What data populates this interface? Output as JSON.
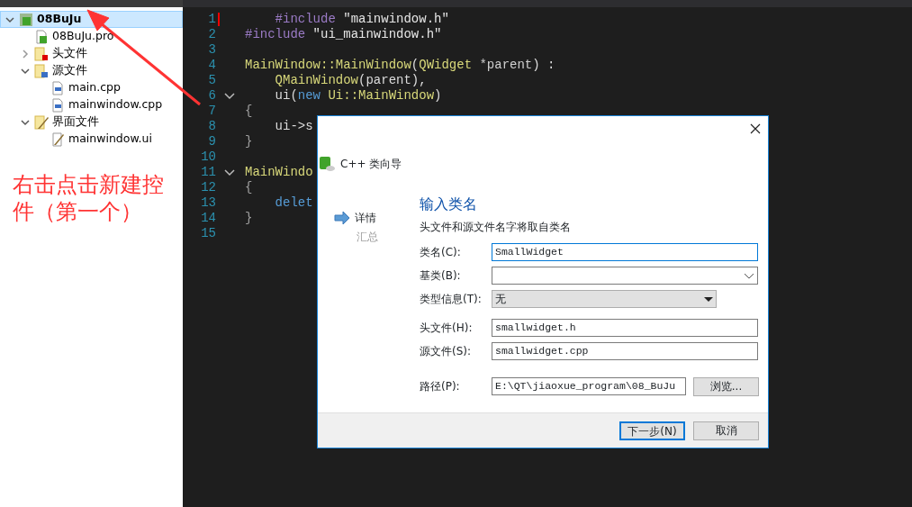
{
  "project_tree": [
    {
      "label": "08BuJu",
      "kind": "project",
      "selected": true,
      "expanded": true,
      "children": [
        {
          "label": "08BuJu.pro",
          "kind": "pro",
          "selected": false
        },
        {
          "label": "头文件",
          "kind": "header-folder",
          "selected": false,
          "expanded": false
        },
        {
          "label": "源文件",
          "kind": "source-folder",
          "selected": false,
          "expanded": true,
          "children": [
            {
              "label": "main.cpp",
              "kind": "cpp",
              "selected": false
            },
            {
              "label": "mainwindow.cpp",
              "kind": "cpp",
              "selected": false
            }
          ]
        },
        {
          "label": "界面文件",
          "kind": "form-folder",
          "selected": false,
          "expanded": true,
          "children": [
            {
              "label": "mainwindow.ui",
              "kind": "ui",
              "selected": false
            }
          ]
        }
      ]
    }
  ],
  "editor": {
    "lines": [
      {
        "number": "1",
        "modified": true,
        "foldable": false,
        "tokens": [
          {
            "text": "    #include",
            "kind": "preproc"
          },
          {
            "text": " \"mainwindow.h\"",
            "kind": "string"
          }
        ]
      },
      {
        "number": "2",
        "modified": false,
        "foldable": false,
        "tokens": [
          {
            "text": "#include",
            "kind": "preproc"
          },
          {
            "text": " \"ui_mainwindow.h\"",
            "kind": "string"
          }
        ]
      },
      {
        "number": "3",
        "modified": false,
        "foldable": false
      },
      {
        "number": "4",
        "modified": false,
        "foldable": false,
        "tokens": [
          {
            "text": "MainWindow::MainWindow",
            "kind": "type"
          },
          {
            "text": "(",
            "kind": "plain"
          },
          {
            "text": "QWidget",
            "kind": "type"
          },
          {
            "text": " *parent",
            "kind": "param"
          },
          {
            "text": ") :",
            "kind": "plain"
          }
        ]
      },
      {
        "number": "5",
        "modified": false,
        "foldable": false,
        "tokens": [
          {
            "text": "    QMainWindow",
            "kind": "type"
          },
          {
            "text": "(parent),",
            "kind": "plain"
          }
        ]
      },
      {
        "number": "6",
        "modified": false,
        "foldable": true,
        "tokens": [
          {
            "text": "    ui(",
            "kind": "plain"
          },
          {
            "text": "new",
            "kind": "keyword"
          },
          {
            "text": " Ui::MainWindow",
            "kind": "type"
          },
          {
            "text": ")",
            "kind": "plain"
          }
        ]
      },
      {
        "number": "7",
        "modified": false,
        "foldable": false,
        "tokens": [
          {
            "text": "{",
            "kind": "brace"
          }
        ]
      },
      {
        "number": "8",
        "modified": false,
        "foldable": false,
        "tokens": [
          {
            "text": "    ui->s",
            "kind": "plain"
          }
        ]
      },
      {
        "number": "9",
        "modified": false,
        "foldable": false,
        "tokens": [
          {
            "text": "}",
            "kind": "brace"
          }
        ]
      },
      {
        "number": "10",
        "modified": false,
        "foldable": false
      },
      {
        "number": "11",
        "modified": false,
        "foldable": true,
        "tokens": [
          {
            "text": "MainWindo",
            "kind": "type"
          }
        ]
      },
      {
        "number": "12",
        "modified": false,
        "foldable": false,
        "tokens": [
          {
            "text": "{",
            "kind": "brace"
          }
        ]
      },
      {
        "number": "13",
        "modified": false,
        "foldable": false,
        "tokens": [
          {
            "text": "    delet",
            "kind": "keyword"
          }
        ]
      },
      {
        "number": "14",
        "modified": false,
        "foldable": false,
        "tokens": [
          {
            "text": "}",
            "kind": "brace"
          }
        ]
      },
      {
        "number": "15",
        "modified": false,
        "foldable": false
      }
    ]
  },
  "dialog": {
    "title": "C++ 类向导",
    "steps": [
      {
        "label": "详情",
        "selected": true
      },
      {
        "label": "汇总",
        "selected": false
      }
    ],
    "heading": "输入类名",
    "description": "头文件和源文件名字将取自类名",
    "fields": [
      {
        "label": "类名(C):",
        "kind": "text",
        "value": "SmallWidget",
        "focused": true
      },
      {
        "label": "基类(B):",
        "kind": "combo",
        "focused": false
      },
      {
        "label": "类型信息(T):",
        "kind": "dropdown",
        "value": "无",
        "focused": false
      },
      {
        "label": "头文件(H):",
        "kind": "text",
        "value": "smallwidget.h",
        "focused": false
      },
      {
        "label": "源文件(S):",
        "kind": "text",
        "value": "smallwidget.cpp",
        "focused": false
      },
      {
        "label": "路径(P):",
        "kind": "path",
        "value": "E:\\QT\\jiaoxue_program\\08_BuJu",
        "button": "浏览...",
        "focused": false
      }
    ],
    "buttons": [
      {
        "label": "下一步(N)",
        "default": true
      },
      {
        "label": "取消",
        "default": false
      }
    ]
  },
  "annotation": {
    "text": "右击点击新建控件（第一个）",
    "color": "#ff3333"
  }
}
